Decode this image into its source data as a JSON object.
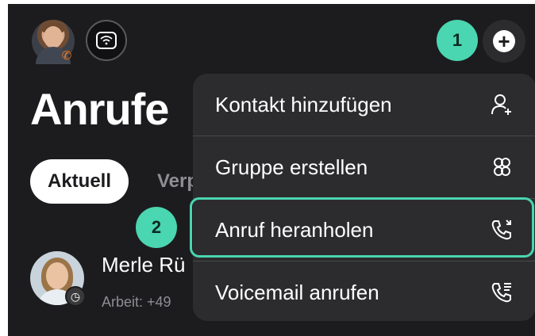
{
  "header": {
    "title": "Anrufe",
    "avatar_icon": "user-avatar",
    "status_icon": "phone-badge-icon",
    "wifi_icon": "wifi-icon",
    "add_icon": "plus-icon"
  },
  "annotations": {
    "step1": "1",
    "step2": "2",
    "accent_color": "#4ad6b0"
  },
  "tabs": {
    "active": "Aktuell",
    "other_partial": "Verp"
  },
  "contact": {
    "name_partial": "Merle Rü",
    "detail_partial": "Arbeit: +49"
  },
  "menu": {
    "items": [
      {
        "label": "Kontakt hinzufügen",
        "icon": "add-contact-icon"
      },
      {
        "label": "Gruppe erstellen",
        "icon": "group-icon"
      },
      {
        "label": "Anruf heranholen",
        "icon": "call-pickup-icon"
      },
      {
        "label": "Voicemail anrufen",
        "icon": "voicemail-call-icon"
      }
    ]
  }
}
